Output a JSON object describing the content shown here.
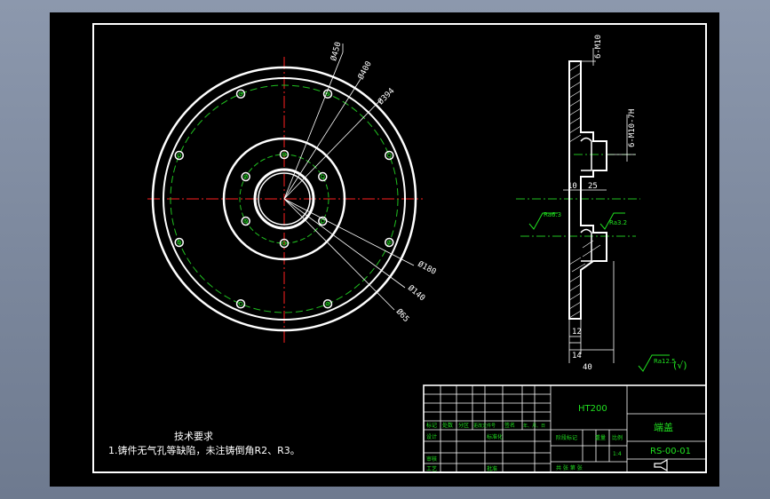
{
  "colors": {
    "background": "#000000",
    "outline": "#ffffff",
    "centerline": "#ff2020",
    "hidden_circle": "#20c020",
    "dimension": "#ffffff",
    "title_block_text": "#20e020",
    "window_frame": "#7f8ba0"
  },
  "plan_view": {
    "dimensions": {
      "d450": "Ø450",
      "d400": "Ø400",
      "d394": "Ø394",
      "d180": "Ø180",
      "d140": "Ø140",
      "d65": "Ø65"
    },
    "bolt_holes_outer_count": 8,
    "bolt_holes_inner_count": 6
  },
  "section_view": {
    "dimensions": {
      "thread_top": "6-M10",
      "thread_mid": "6-M10-7H",
      "dim_10": "10",
      "dim_25": "25",
      "dim_12": "12",
      "dim_14": "14",
      "dim_40": "40"
    },
    "roughness": {
      "left": "Ra6.3",
      "right": "Ra3.2",
      "general": "Ra12.5",
      "general_suffix": "(√)"
    }
  },
  "tech_requirements": {
    "heading": "技术要求",
    "line1": "1.铸件无气孔等缺陷，未注铸倒角R2、R3。"
  },
  "title_block": {
    "material": "HT200",
    "part_name": "端盖",
    "drawing_number": "RS-00-01",
    "scale_label": "比例",
    "scale": "1:4",
    "weight_label": "重量",
    "stage_label": "阶段标记",
    "sheet_text": "共  张  第  张",
    "header_cells": [
      "标记",
      "处数",
      "分区",
      "更改文件号",
      "签名",
      "年、月、日"
    ],
    "row_designer": "设计",
    "row_standard": "标准化",
    "row_check": "审核",
    "row_process": "工艺",
    "row_approve": "批准"
  }
}
